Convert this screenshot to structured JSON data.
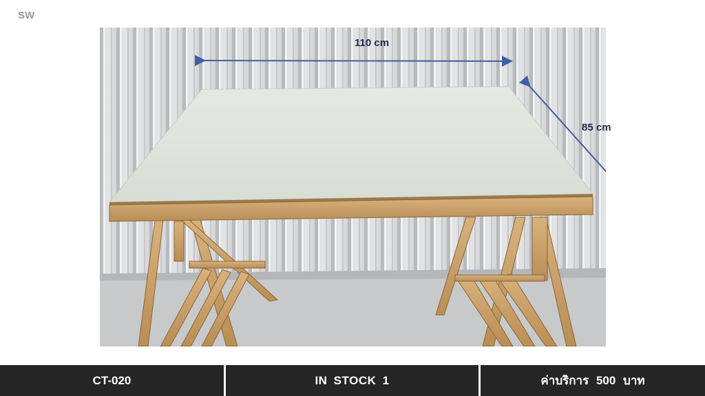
{
  "corner_tag": "SW",
  "photo": {
    "width_label": "110 cm",
    "depth_label": "85 cm",
    "arrow_color": "#3f5fa3"
  },
  "footer": {
    "code": "CT-020",
    "stock": "IN STOCK 1",
    "price": "ค่าบริการ 500 บาท"
  }
}
